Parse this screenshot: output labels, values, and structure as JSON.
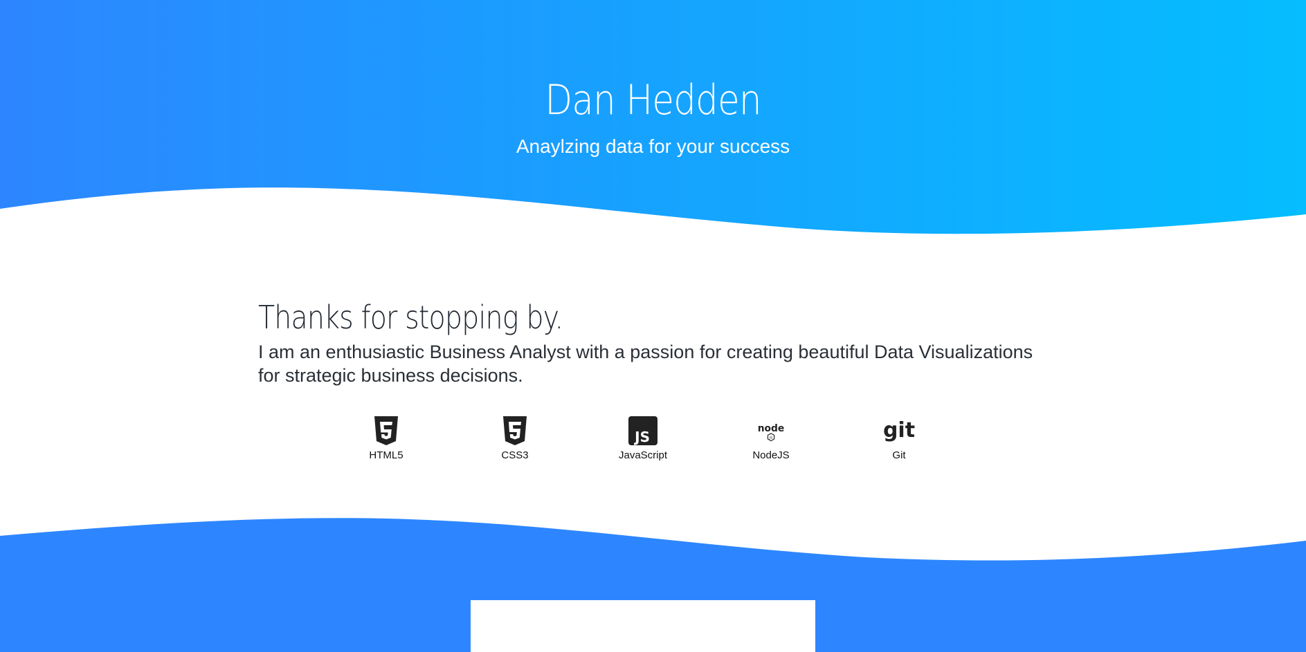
{
  "header": {
    "name": "Dan Hedden",
    "tagline": "Anaylzing data for your success"
  },
  "about": {
    "heading": "Thanks for stopping by.",
    "text": "I am an enthusiastic Business Analyst with a passion for creating beautiful Data Visualizations for strategic business decisions."
  },
  "skills": [
    {
      "label": "HTML5",
      "icon": "html5-icon"
    },
    {
      "label": "CSS3",
      "icon": "css3-icon"
    },
    {
      "label": "JavaScript",
      "icon": "javascript-icon"
    },
    {
      "label": "NodeJS",
      "icon": "nodejs-icon"
    },
    {
      "label": "Git",
      "icon": "git-icon"
    }
  ],
  "colors": {
    "hero_gradient_start": "#2d86ff",
    "hero_gradient_end": "#05bdff",
    "bottom_blue": "#2d86ff",
    "icon_dark": "#222222"
  }
}
